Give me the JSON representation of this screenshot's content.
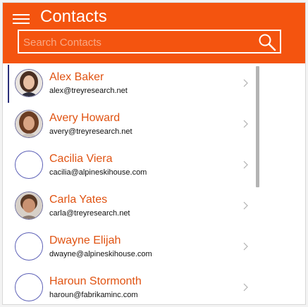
{
  "header": {
    "title": "Contacts",
    "menu_icon": "hamburger-menu-icon"
  },
  "search": {
    "placeholder": "Search Contacts",
    "value": "",
    "icon": "search-icon"
  },
  "colors": {
    "accent": "#f4540f",
    "name_text": "#e05312",
    "selection_bar": "#2b2f7a",
    "avatar_ring": "#5b5fb6"
  },
  "contacts": [
    {
      "name": "Alex Baker",
      "email": "alex@treyresearch.net",
      "avatar": "photo",
      "selected": true
    },
    {
      "name": "Avery Howard",
      "email": "avery@treyresearch.net",
      "avatar": "photo",
      "selected": false
    },
    {
      "name": "Cacilia Viera",
      "email": "cacilia@alpineskihouse.com",
      "avatar": "empty",
      "selected": false
    },
    {
      "name": "Carla Yates",
      "email": "carla@treyresearch.net",
      "avatar": "photo",
      "selected": false
    },
    {
      "name": "Dwayne Elijah",
      "email": "dwayne@alpineskihouse.com",
      "avatar": "empty",
      "selected": false
    },
    {
      "name": "Haroun Stormonth",
      "email": "haroun@fabrikaminc.com",
      "avatar": "empty",
      "selected": false
    }
  ]
}
